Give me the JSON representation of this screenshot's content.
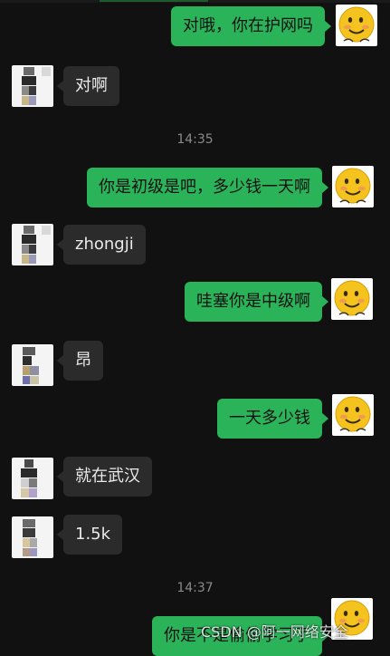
{
  "colors": {
    "background": "#111111",
    "outgoing_bubble": "#2bb35a",
    "incoming_bubble": "#2b2b2b",
    "timestamp": "#8a8a8a"
  },
  "avatars": {
    "me": "smiley-emoji-avatar",
    "other": "pixelated-avatar"
  },
  "messages": [
    {
      "side": "out",
      "text": "对哦，你在护网吗"
    },
    {
      "side": "in",
      "text": "对啊"
    },
    {
      "side": "time",
      "text": "14:35"
    },
    {
      "side": "out",
      "text": "你是初级是吧，多少钱一天啊"
    },
    {
      "side": "in",
      "text": "zhongji"
    },
    {
      "side": "out",
      "text": "哇塞你是中级啊"
    },
    {
      "side": "in",
      "text": "昂"
    },
    {
      "side": "out",
      "text": "一天多少钱"
    },
    {
      "side": "in",
      "text": "就在武汉"
    },
    {
      "side": "in",
      "text": "1.5k"
    },
    {
      "side": "time",
      "text": "14:37"
    },
    {
      "side": "out",
      "text": "你是不是偷偷学习了"
    }
  ],
  "watermark": "CSDN @阿一网络安全"
}
